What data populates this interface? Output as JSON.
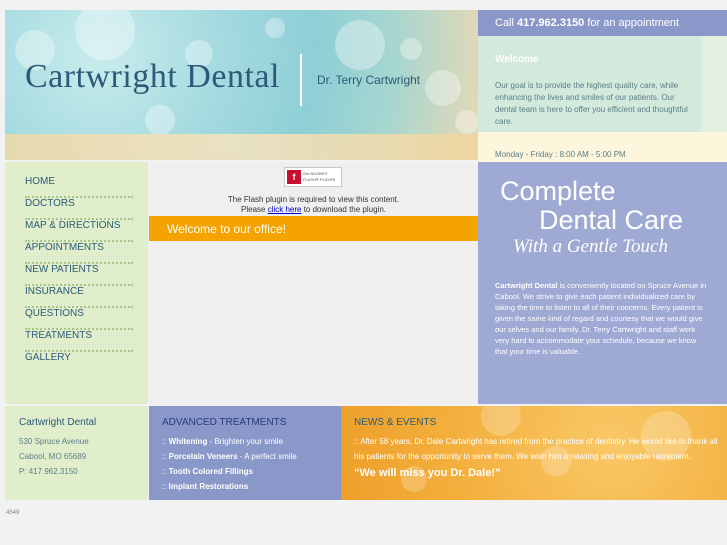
{
  "header": {
    "logo_text": "Cartwright Dental",
    "doctor_name": "Dr. Terry Cartwright",
    "call_prefix": "Call ",
    "call_number": "417.962.3150",
    "call_suffix": " for an appointment",
    "welcome_title": "Welcome",
    "welcome_text": "Our goal is to provide the highest quality care, while enhancing the lives and smiles of our patients. Our dental team is here to offer you efficient and thoughtful care.",
    "hours": "Monday - Friday : 8:00 AM - 5:00 PM"
  },
  "nav": {
    "items": [
      {
        "label": "HOME"
      },
      {
        "label": "DOCTORS"
      },
      {
        "label": "MAP & DIRECTIONS"
      },
      {
        "label": "APPOINTMENTS"
      },
      {
        "label": "NEW PATIENTS"
      },
      {
        "label": "INSURANCE"
      },
      {
        "label": "QUESTIONS"
      },
      {
        "label": "TREATMENTS"
      },
      {
        "label": "GALLERY"
      }
    ]
  },
  "content": {
    "flash_badge_line1": "Get ADOBE®",
    "flash_badge_line2": "FLASH® PLAYER",
    "flash_required": "The Flash plugin is required to view this content.",
    "please": "Please ",
    "click_here": "click here",
    "download_suffix": " to download the plugin.",
    "welcome_bar": "Welcome to our office!"
  },
  "promo": {
    "line1": "Complete",
    "line2": "Dental Care",
    "line3": "With a Gentle Touch",
    "practice_name": "Cartwright Dental",
    "body": " is conveniently located on Spruce Avenue in Cabool.  We strive to give each patient individualized care by taking the time to listen to all of their concerns.  Every patient is given the same kind of regard and courtesy that we would give our selves and our family.  Dr. Terry Cartwright and staff work very hard to accommodate your schedule, because we know that your time is valuable."
  },
  "footer": {
    "address_title": "Cartwright Dental",
    "street": "530 Spruce Avenue",
    "city": "Cabool, MO 65689",
    "phone": "P: 417.962.3150",
    "adv_title": "ADVANCED TREATMENTS",
    "adv_items": [
      {
        "name": "Whitening",
        "desc": " - Brighten your smile"
      },
      {
        "name": "Porcelain Veneers",
        "desc": " - A perfect smile"
      },
      {
        "name": "Tooth Colored Fillings",
        "desc": ""
      },
      {
        "name": "Implant Restorations",
        "desc": ""
      }
    ],
    "news_title": "NEWS & EVENTS",
    "news_text": ":: After 58 years, Dr. Dale Cartwright has retired from the practice of dentistry. He would like to thank all his patients for the opportunity to serve them. We wish him a relaxing and enjoyable retirement.",
    "news_quote": "“We will miss you Dr. Dale!”"
  },
  "counter": "4549",
  "colors": {
    "nav_bg": "#e0eecb",
    "accent_orange": "#f4a300",
    "promo_bg": "#9ea9d4",
    "call_bar": "#8a98c9",
    "text_blue": "#2c5a78"
  }
}
